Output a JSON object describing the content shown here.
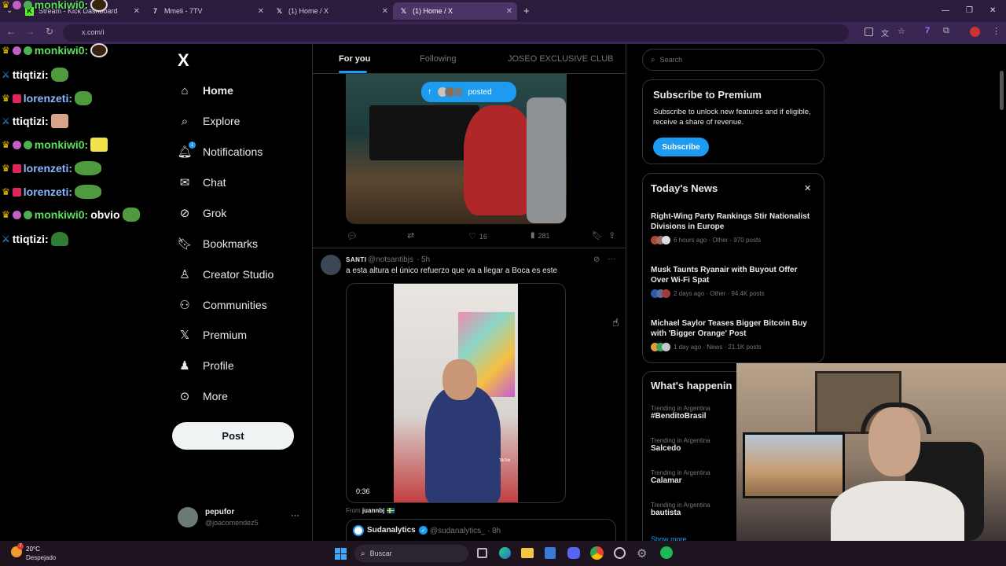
{
  "browser": {
    "tabs": [
      {
        "label": "Stream - Kick Dashboard",
        "icon": "kick-icon"
      },
      {
        "label": "Mmeli - 7TV",
        "icon": "7tv-icon"
      },
      {
        "label": "(1) Home / X",
        "icon": "x-icon"
      },
      {
        "label": "(1) Home / X",
        "icon": "x-icon"
      }
    ],
    "url": "x.com/i"
  },
  "chat": [
    {
      "user": "monkiwi0:",
      "msg": "",
      "color": "#5ee05e"
    },
    {
      "user": "monkiwi0:",
      "msg": "",
      "color": "#5ee05e"
    },
    {
      "user": "ttiqtizi:",
      "msg": "",
      "color": "#ffffff"
    },
    {
      "user": "lorenzeti:",
      "msg": "",
      "color": "#8fb7ff"
    },
    {
      "user": "ttiqtizi:",
      "msg": "",
      "color": "#ffffff"
    },
    {
      "user": "monkiwi0:",
      "msg": "",
      "color": "#5ee05e"
    },
    {
      "user": "lorenzeti:",
      "msg": "",
      "color": "#8fb7ff"
    },
    {
      "user": "lorenzeti:",
      "msg": "",
      "color": "#8fb7ff"
    },
    {
      "user": "monkiwi0:",
      "msg": "obvio",
      "color": "#5ee05e"
    },
    {
      "user": "ttiqtizi:",
      "msg": "",
      "color": "#ffffff"
    }
  ],
  "sidebar": {
    "logo": "X",
    "items": [
      {
        "label": "Home",
        "icon": "home-icon"
      },
      {
        "label": "Explore",
        "icon": "search-icon"
      },
      {
        "label": "Notifications",
        "icon": "bell-icon"
      },
      {
        "label": "Chat",
        "icon": "mail-icon"
      },
      {
        "label": "Grok",
        "icon": "grok-icon"
      },
      {
        "label": "Bookmarks",
        "icon": "bookmark-icon"
      },
      {
        "label": "Creator Studio",
        "icon": "creator-icon"
      },
      {
        "label": "Communities",
        "icon": "communities-icon"
      },
      {
        "label": "Premium",
        "icon": "x-icon"
      },
      {
        "label": "Profile",
        "icon": "profile-icon"
      },
      {
        "label": "More",
        "icon": "more-icon"
      }
    ],
    "notif_count": "1",
    "post_label": "Post",
    "account": {
      "name": "pepufor",
      "handle": "@joacomendez5"
    }
  },
  "feed": {
    "tabs": [
      "For you",
      "Following",
      "JOSEO EXCLUSIVE CLUB"
    ],
    "posted_pill": "posted",
    "post1": {
      "likes": "16",
      "views": "281"
    },
    "post2": {
      "name": "SANTI",
      "handle": "@notsantibjs",
      "time": "5h",
      "text": "a esta altura el único refuerzo que va a llegar a Boca es este",
      "duration": "0:36",
      "from": "From",
      "from_user": "juannbj",
      "watermark": "TikTok"
    },
    "post3": {
      "name": "Sudanalytics",
      "handle": "@sudanalytics_",
      "time": "8h"
    }
  },
  "right": {
    "search_placeholder": "Search",
    "premium": {
      "title": "Subscribe to Premium",
      "body": "Subscribe to unlock new features and if eligible, receive a share of revenue.",
      "button": "Subscribe"
    },
    "news": {
      "title": "Today's News",
      "items": [
        {
          "title": "Right-Wing Party Rankings Stir Nationalist Divisions in Europe",
          "meta": "6 hours ago · Other · 970 posts"
        },
        {
          "title": "Musk Taunts Ryanair with Buyout Offer Over Wi-Fi Spat",
          "meta": "2 days ago · Other · 94.4K posts"
        },
        {
          "title": "Michael Saylor Teases Bigger Bitcoin Buy with 'Bigger Orange' Post",
          "meta": "1 day ago · News · 21.1K posts"
        }
      ]
    },
    "happening": {
      "title": "What's happenin",
      "trends": [
        {
          "context": "Trending in Argentina",
          "name": "#BenditoBrasil"
        },
        {
          "context": "Trending in Argentina",
          "name": "Salcedo"
        },
        {
          "context": "Trending in Argentina",
          "name": "Calamar"
        },
        {
          "context": "Trending in Argentina",
          "name": "bautista"
        }
      ],
      "show_more": "Show more"
    }
  },
  "taskbar": {
    "temp": "20°C",
    "weather": "Despejado",
    "search_placeholder": "Buscar",
    "weather_badge": "7"
  },
  "colors": {
    "accent": "#1d9bf0",
    "bg": "#000000",
    "border": "#2f3336",
    "browser": "#2b1b3d"
  }
}
